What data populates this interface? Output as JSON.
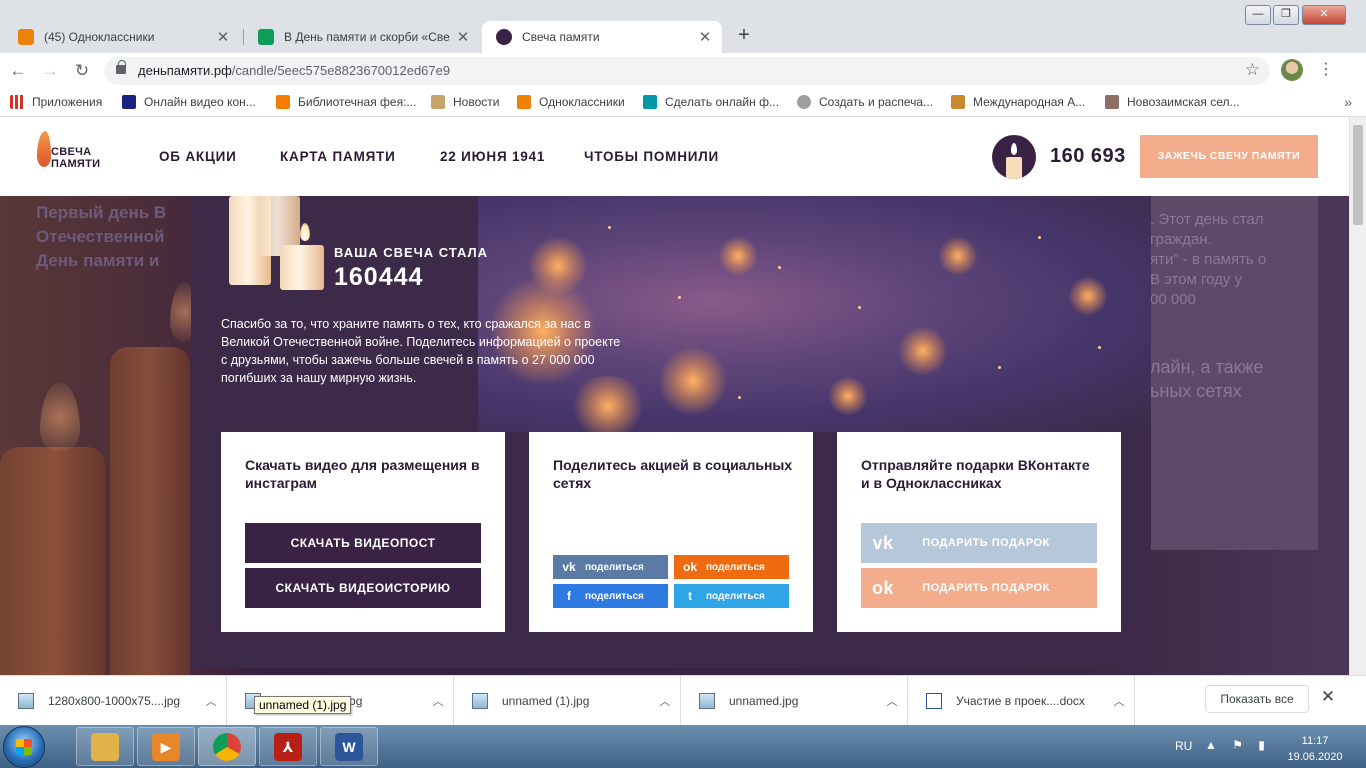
{
  "browser": {
    "tabs": [
      {
        "title": "(45) Одноклассники",
        "icon": "ok-icon",
        "color": "#ee8208"
      },
      {
        "title": "В День памяти и скорби «Свеча",
        "icon": "document-green-icon",
        "color": "#0c9d58"
      },
      {
        "title": "Свеча памяти",
        "icon": "candle-icon",
        "color": "#3a2244"
      }
    ],
    "url_host": "деньпамяти.рф",
    "url_path": "/candle/5eec575e8823670012ed67e9",
    "bookmarks": [
      {
        "label": "Приложения",
        "icon": "apps-grid-icon"
      },
      {
        "label": "Онлайн видео кон...",
        "icon": "video-icon"
      },
      {
        "label": "Библиотечная фея:...",
        "icon": "blogger-icon"
      },
      {
        "label": "Новости",
        "icon": "news-icon"
      },
      {
        "label": "Одноклассники",
        "icon": "ok-icon"
      },
      {
        "label": "Сделать онлайн ф...",
        "icon": "online-icon"
      },
      {
        "label": "Создать и распеча...",
        "icon": "print-icon"
      },
      {
        "label": "Международная А...",
        "icon": "award-icon"
      },
      {
        "label": "Новозаимская сел...",
        "icon": "photo-icon"
      }
    ]
  },
  "site": {
    "logo_line1": "СВЕЧА",
    "logo_line2": "ПАМЯТИ",
    "nav": [
      "ОБ АКЦИИ",
      "КАРТА ПАМЯТИ",
      "22 ИЮНЯ 1941",
      "ЧТОБЫ ПОМНИЛИ"
    ],
    "counter": "160 693",
    "light_button": "ЗАЖЕЧЬ СВЕЧУ ПАМЯТИ",
    "background_left_lines": [
      "Первый день В",
      "Отечественной",
      "День памяти и"
    ],
    "background_right_lines": [
      ". Этот день стал",
      "граждан.",
      "яти\" - в память о",
      "В этом году у",
      "00 000"
    ],
    "background_right_lines2": [
      "лайн, а также",
      "ьных сетях"
    ]
  },
  "modal": {
    "candle_label": "ВАША СВЕЧА СТАЛА",
    "candle_number": "160444",
    "thanks_text": "Спасибо за то, что храните память о тех, кто сражался за нас в Великой Отечественной войне. Поделитесь информацией о проекте с друзьями, чтобы зажечь больше свечей в память о 27 000 000 погибших за нашу мирную жизнь.",
    "card_download": {
      "title": "Скачать видео для размещения в инстаграм",
      "btn_post": "СКАЧАТЬ ВИДЕОПОСТ",
      "btn_story": "СКАЧАТЬ ВИДЕОИСТОРИЮ"
    },
    "card_share": {
      "title": "Поделитесь акцией в социальных сетях",
      "buttons": [
        {
          "label": "поделиться",
          "network": "vk",
          "glyph": "vk",
          "color": "#5b7ba6"
        },
        {
          "label": "поделиться",
          "network": "ok",
          "glyph": "ok",
          "color": "#ee6b10"
        },
        {
          "label": "поделиться",
          "network": "facebook",
          "glyph": "f",
          "color": "#2d7be0"
        },
        {
          "label": "поделиться",
          "network": "twitter",
          "glyph": "t",
          "color": "#2fa4e7"
        }
      ]
    },
    "card_gift": {
      "title": "Отправляйте подарки ВКонтакте и в Одноклассниках",
      "btn_vk": "ПОДАРИТЬ ПОДАРОК",
      "btn_ok": "ПОДАРИТЬ ПОДАРОК",
      "vk_glyph": "vk",
      "ok_glyph": "ok",
      "vk_color": "#b7c7da",
      "ok_color": "#f4ad8c"
    }
  },
  "downloads": {
    "items": [
      {
        "name": "1280x800-1000x75....jpg",
        "type": "image"
      },
      {
        "name": "unnamed (1).jpg",
        "type": "image"
      },
      {
        "name": "unnamed (1).jpg",
        "type": "image"
      },
      {
        "name": "unnamed.jpg",
        "type": "image"
      },
      {
        "name": "Участие в проек....docx",
        "type": "word"
      }
    ],
    "tooltip": "unnamed (1).jpg",
    "show_all": "Показать все"
  },
  "taskbar": {
    "apps": [
      {
        "name": "explorer",
        "icon": "folder-icon",
        "color": "#e0b34a"
      },
      {
        "name": "media",
        "icon": "media-player-icon",
        "color": "#e8862a"
      },
      {
        "name": "chrome",
        "icon": "chrome-icon",
        "color": "#3c8a3c"
      },
      {
        "name": "acrobat",
        "icon": "pdf-icon",
        "color": "#b81f14"
      },
      {
        "name": "word",
        "icon": "word-icon",
        "color": "#2b579a"
      }
    ],
    "language": "RU",
    "time": "11:17",
    "date": "19.06.2020"
  }
}
